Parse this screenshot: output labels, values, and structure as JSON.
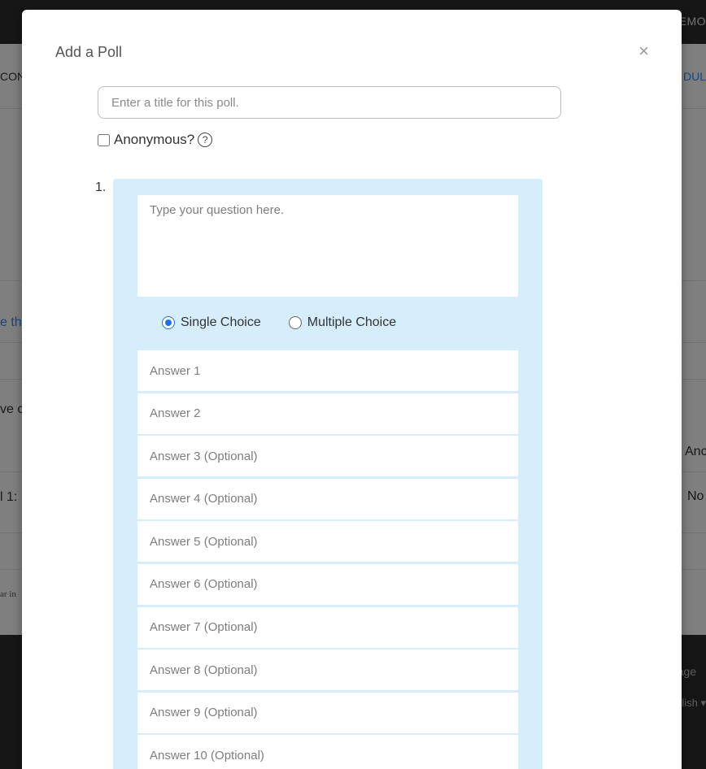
{
  "background": {
    "topbar_right": "EMO",
    "nav_left": "CON",
    "nav_right": "DUL",
    "fragment_link": "e thi",
    "fragment_left_1": "ve c",
    "fragment_left_2": "l 1:",
    "fragment_right_1": "Anc",
    "fragment_right_2": "No",
    "fragment_small": "ar in",
    "footer_1": "age",
    "footer_2": "lish ▾"
  },
  "modal": {
    "title": "Add a Poll",
    "close_symbol": "×",
    "poll_title_placeholder": "Enter a title for this poll.",
    "anonymous_label": "Anonymous?",
    "help_symbol": "?"
  },
  "question": {
    "number": "1.",
    "placeholder": "Type your question here.",
    "choice_types": [
      {
        "label": "Single Choice",
        "selected": true
      },
      {
        "label": "Multiple Choice",
        "selected": false
      }
    ],
    "answers": [
      "Answer 1",
      "Answer 2",
      "Answer 3 (Optional)",
      "Answer 4 (Optional)",
      "Answer 5 (Optional)",
      "Answer 6 (Optional)",
      "Answer 7 (Optional)",
      "Answer 8 (Optional)",
      "Answer 9 (Optional)",
      "Answer 10 (Optional)"
    ]
  },
  "colors": {
    "card_background": "#d6eefc",
    "radio_selected": "#1a73e8",
    "overlay": "rgba(0,0,0,0.5)"
  }
}
